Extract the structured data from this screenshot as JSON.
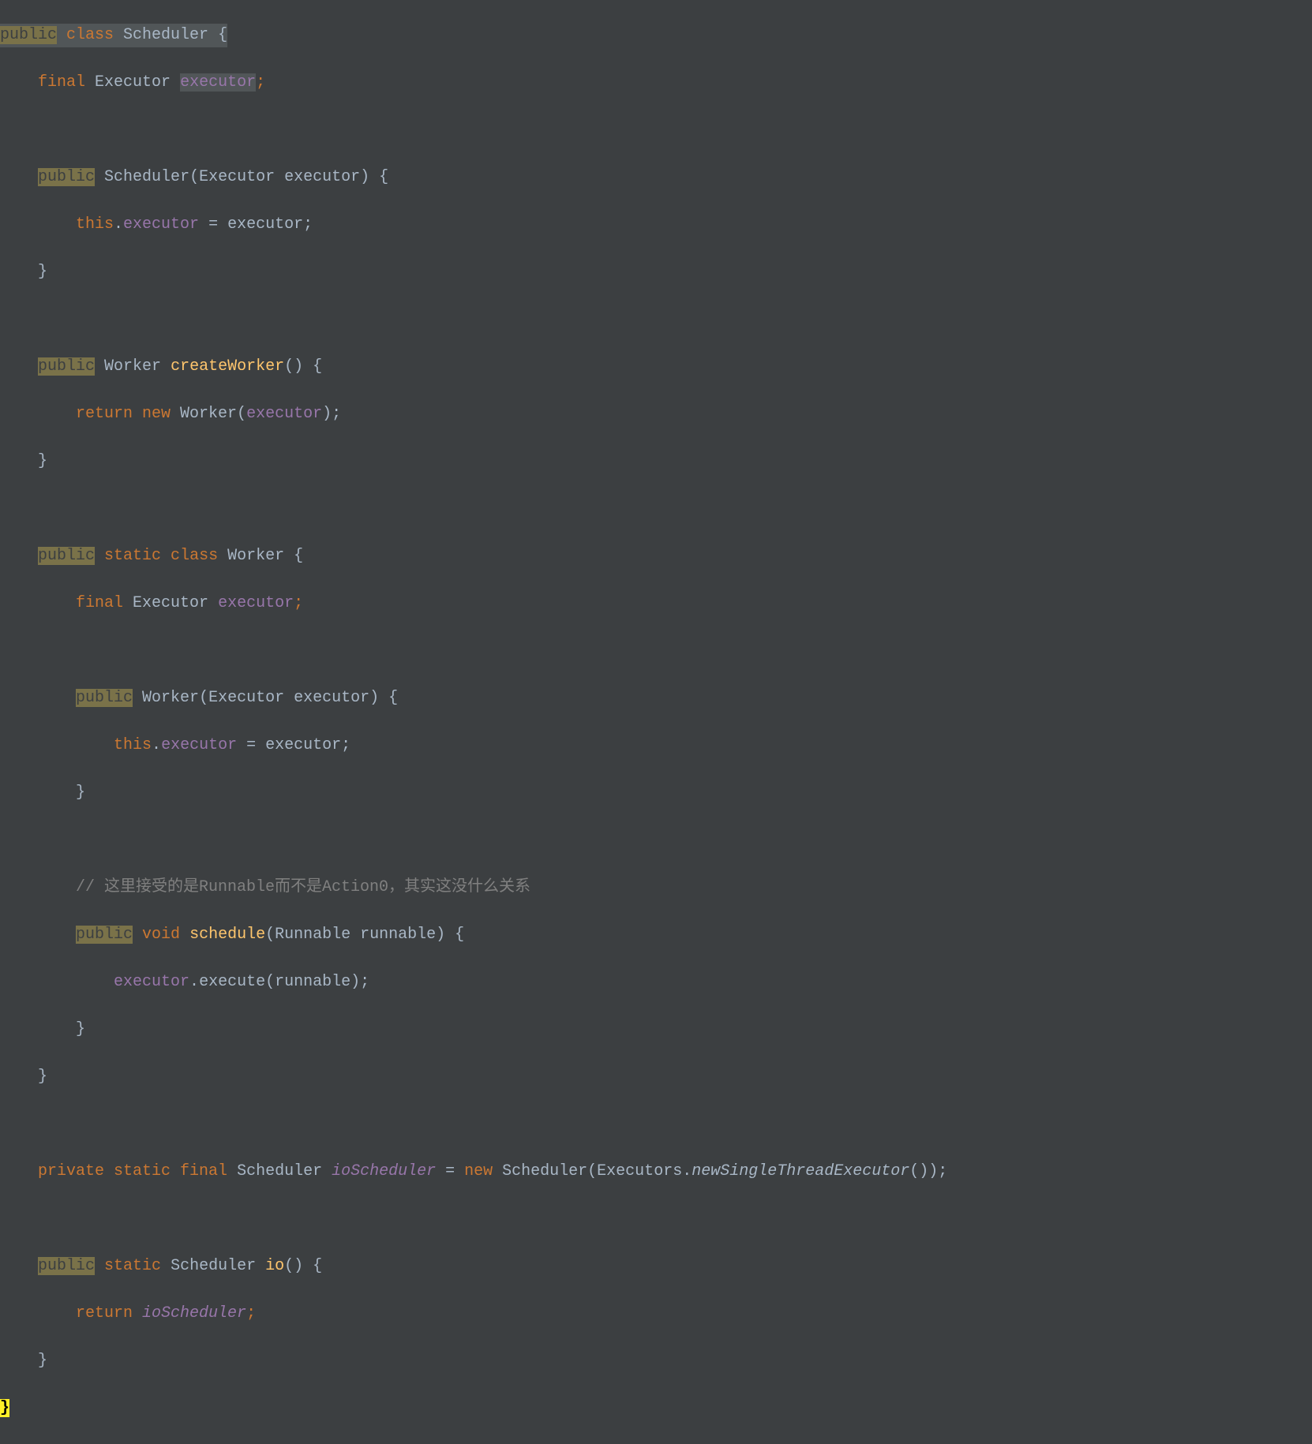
{
  "code": {
    "line1": {
      "public": "public",
      "class": " class ",
      "scheduler": "Scheduler",
      "brace": " {"
    },
    "line2": {
      "indent": "    ",
      "final": "final ",
      "executor_type": "Executor ",
      "executor": "executor",
      "semi": ";"
    },
    "line4": {
      "indent": "    ",
      "public": "public",
      "space": " ",
      "scheduler": "Scheduler",
      "params": "(Executor executor) {"
    },
    "line5": {
      "indent": "        ",
      "this": "this",
      "dot": ".",
      "executor": "executor",
      "assign": " = executor;"
    },
    "line6": {
      "indent": "    ",
      "brace": "}"
    },
    "line8": {
      "indent": "    ",
      "public": "public",
      "space": " ",
      "worker": "Worker ",
      "method": "createWorker",
      "params": "() {"
    },
    "line9": {
      "indent": "        ",
      "return": "return new ",
      "worker": "Worker(",
      "executor": "executor",
      "end": ");"
    },
    "line10": {
      "indent": "    ",
      "brace": "}"
    },
    "line12": {
      "indent": "    ",
      "public": "public",
      "space": " ",
      "static_class": "static class ",
      "worker": "Worker {"
    },
    "line13": {
      "indent": "        ",
      "final": "final ",
      "executor_type": "Executor ",
      "executor": "executor",
      "semi": ";"
    },
    "line15": {
      "indent": "        ",
      "public": "public",
      "space": " ",
      "worker": "Worker",
      "params": "(Executor executor) {"
    },
    "line16": {
      "indent": "            ",
      "this": "this",
      "dot": ".",
      "executor": "executor",
      "assign": " = executor;"
    },
    "line17": {
      "indent": "        ",
      "brace": "}"
    },
    "line19": {
      "indent": "        ",
      "comment": "// 这里接受的是Runnable而不是Action0，其实这没什么关系"
    },
    "line20": {
      "indent": "        ",
      "public": "public",
      "space": " ",
      "void": "void ",
      "method": "schedule",
      "params": "(Runnable runnable) {"
    },
    "line21": {
      "indent": "            ",
      "executor": "executor",
      "dot": ".",
      "method": "execute",
      "params": "(runnable);"
    },
    "line22": {
      "indent": "        ",
      "brace": "}"
    },
    "line23": {
      "indent": "    ",
      "brace": "}"
    },
    "line25": {
      "indent": "    ",
      "private": "private static final ",
      "scheduler": "Scheduler ",
      "ioScheduler": "ioScheduler",
      "assign": " = ",
      "new": "new ",
      "scheduler2": "Scheduler(Executors.",
      "method": "newSingleThreadExecutor",
      "end": "());"
    },
    "line27": {
      "indent": "    ",
      "public": "public",
      "space": " ",
      "static": "static ",
      "scheduler": "Scheduler ",
      "method": "io",
      "params": "() {"
    },
    "line28": {
      "indent": "        ",
      "return": "return ",
      "ioScheduler": "ioScheduler",
      "semi": ";"
    },
    "line29": {
      "indent": "    ",
      "brace": "}"
    },
    "line30": {
      "brace": "}"
    }
  }
}
